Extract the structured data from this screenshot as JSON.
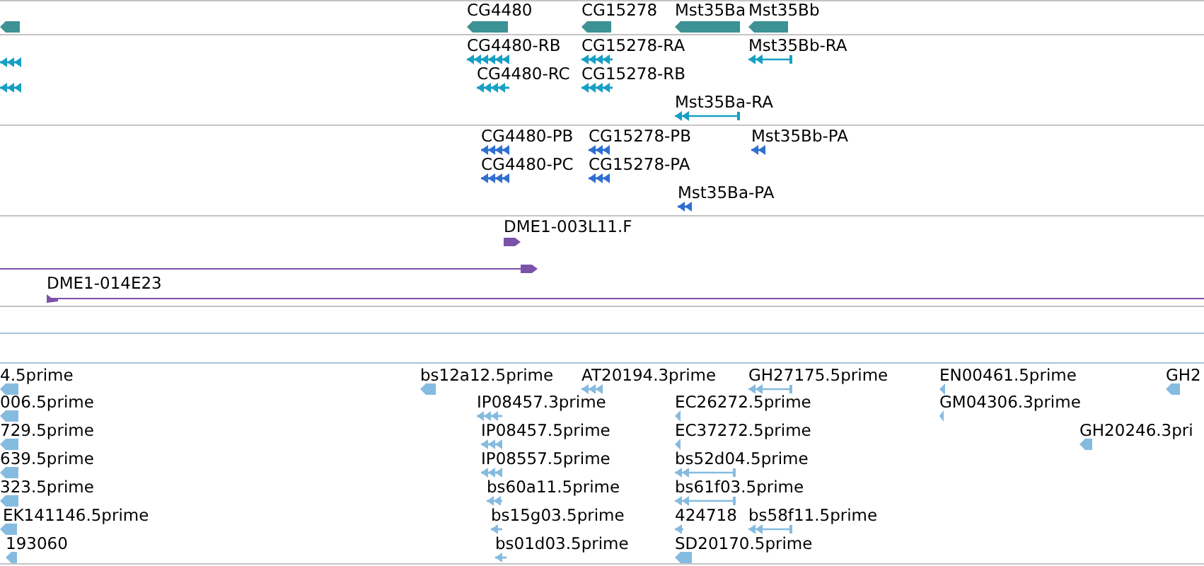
{
  "tracks": [
    {
      "color": "#3d9295",
      "features": [
        {
          "kind": "bar"
        },
        {
          "label": "CG4480",
          "kind": "bar"
        },
        {
          "label": "CG15278",
          "kind": "bar"
        },
        {
          "label": "Mst35Ba",
          "kind": "bar"
        },
        {
          "label": "Mst35Bb",
          "kind": "bar"
        }
      ]
    },
    {
      "color": "#16a0c4",
      "features": [
        {
          "kind": "arrows"
        },
        {
          "kind": "arrows"
        },
        {
          "label": "CG4480-RB",
          "kind": "arrows"
        },
        {
          "label": "CG15278-RA",
          "kind": "arrows"
        },
        {
          "label": "Mst35Bb-RA",
          "kind": "spliced"
        },
        {
          "label": "CG4480-RC",
          "kind": "arrows"
        },
        {
          "label": "CG15278-RB",
          "kind": "arrows"
        },
        {
          "label": "Mst35Ba-RA",
          "kind": "spliced"
        }
      ]
    },
    {
      "color": "#2f6fd0",
      "features": [
        {
          "label": "CG4480-PB",
          "kind": "arrows"
        },
        {
          "label": "CG15278-PB",
          "kind": "arrows"
        },
        {
          "label": "Mst35Bb-PA",
          "kind": "arrows"
        },
        {
          "label": "CG4480-PC",
          "kind": "arrows"
        },
        {
          "label": "CG15278-PA",
          "kind": "arrows"
        },
        {
          "label": "Mst35Ba-PA",
          "kind": "arrows"
        }
      ]
    },
    {
      "color": "#7a52a8",
      "features": [
        {
          "label": "DME1-003L11.F",
          "kind": "clone"
        },
        {
          "kind": "clone_span"
        },
        {
          "label": "DME1-014E23",
          "kind": "clone_start"
        }
      ]
    },
    {
      "color": "#86bbe0",
      "features": [
        {
          "label": "4.5prime",
          "kind": "bar"
        },
        {
          "label": "bs12a12.5prime",
          "kind": "bar"
        },
        {
          "label": "AT20194.3prime",
          "kind": "arrows"
        },
        {
          "label": "GH27175.5prime",
          "kind": "spliced"
        },
        {
          "label": "EN00461.5prime",
          "kind": "bar"
        },
        {
          "label": "GH2",
          "kind": "bar"
        },
        {
          "label": "006.5prime",
          "kind": "bar"
        },
        {
          "label": "IP08457.3prime",
          "kind": "arrows"
        },
        {
          "label": "EC26272.5prime",
          "kind": "bar"
        },
        {
          "label": "GM04306.3prime",
          "kind": "bar"
        },
        {
          "label": "729.5prime",
          "kind": "bar"
        },
        {
          "label": "IP08457.5prime",
          "kind": "arrows"
        },
        {
          "label": "EC37272.5prime",
          "kind": "bar"
        },
        {
          "label": "GH20246.3pri",
          "kind": "bar"
        },
        {
          "label": "639.5prime",
          "kind": "bar"
        },
        {
          "label": "IP08557.5prime",
          "kind": "arrows"
        },
        {
          "label": "bs52d04.5prime",
          "kind": "spliced"
        },
        {
          "label": "323.5prime",
          "kind": "bar"
        },
        {
          "label": "bs60a11.5prime",
          "kind": "arrows"
        },
        {
          "label": "bs61f03.5prime",
          "kind": "spliced"
        },
        {
          "label": "EK141146.5prime",
          "kind": "bar"
        },
        {
          "label": "bs15g03.5prime",
          "kind": "arrows"
        },
        {
          "label": "424718",
          "kind": "arrows"
        },
        {
          "label": "bs58f11.5prime",
          "kind": "spliced"
        },
        {
          "label": "193060",
          "kind": "bar"
        },
        {
          "label": "bs01d03.5prime",
          "kind": "arrows"
        },
        {
          "label": "SD20170.5prime",
          "kind": "bar"
        }
      ]
    }
  ]
}
